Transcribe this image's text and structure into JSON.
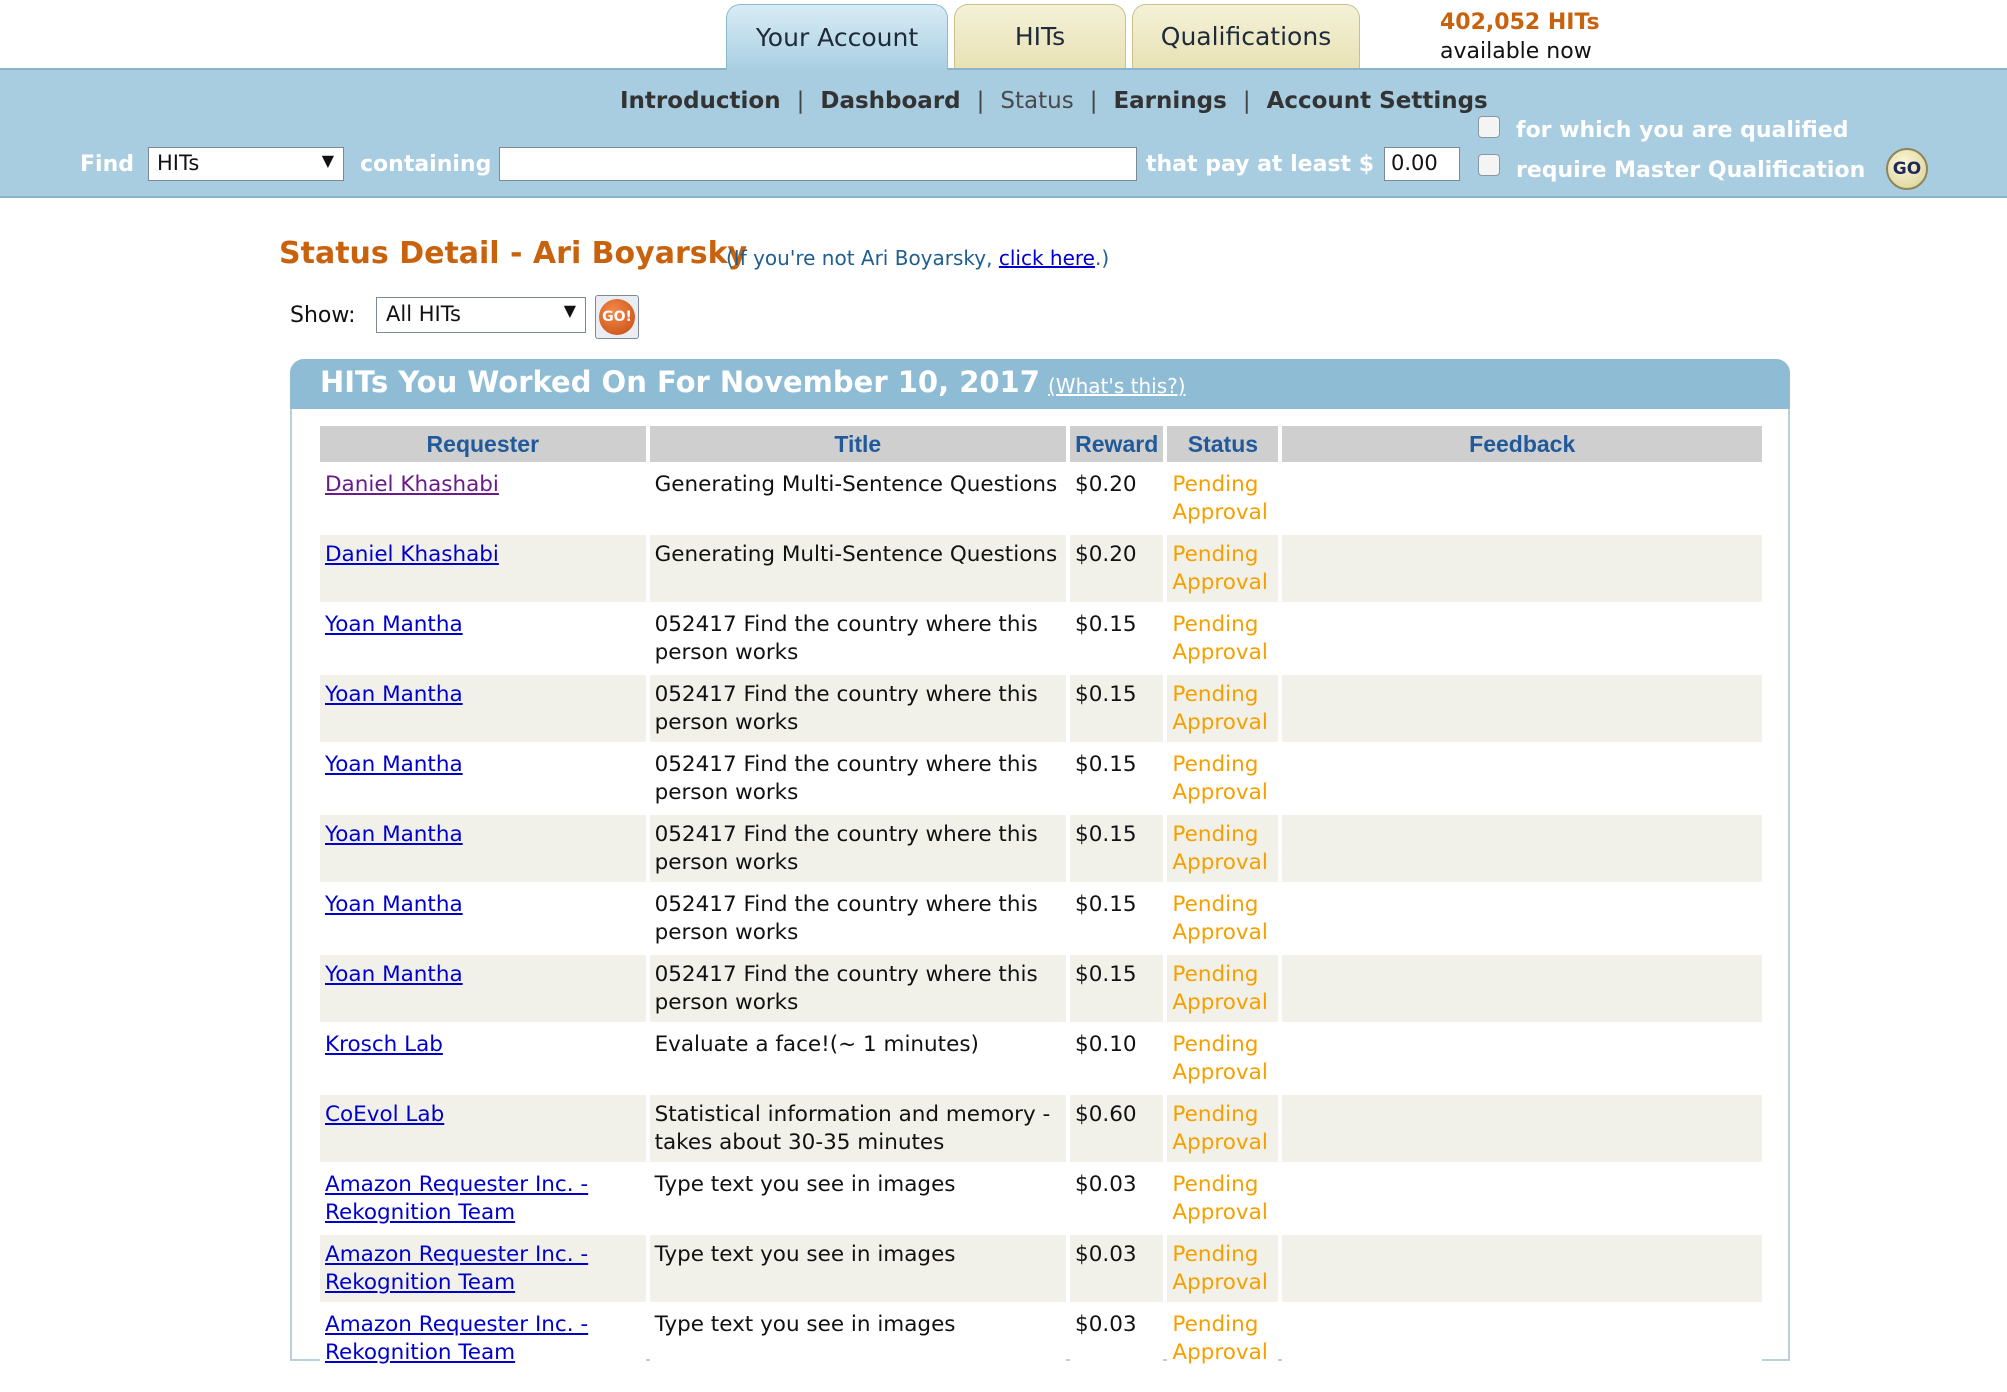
{
  "tabs": [
    {
      "label": "Your Account",
      "active": true
    },
    {
      "label": "HITs",
      "active": false
    },
    {
      "label": "Qualifications",
      "active": false
    }
  ],
  "hits_available": {
    "count": "402,052 HITs",
    "sub": "available now"
  },
  "subnav": {
    "introduction": "Introduction",
    "dashboard": "Dashboard",
    "status": "Status",
    "earnings": "Earnings",
    "account_settings": "Account Settings",
    "separator": "|"
  },
  "search": {
    "find_label": "Find",
    "find_value": "HITs",
    "containing_label": "containing",
    "query": "",
    "pay_label": "that pay at least $",
    "min_pay": "0.00",
    "qualified_label": "for which you are qualified",
    "master_label": "require Master Qualification",
    "go_label": "GO"
  },
  "status": {
    "title": "Status Detail - Ari Boyarsky",
    "note_prefix": "(If you're not Ari Boyarsky, ",
    "note_link": "click here",
    "note_suffix": ".)",
    "show_label": "Show:",
    "show_value": "All HITs",
    "show_go": "GO!"
  },
  "panel": {
    "title": "HITs You Worked On For November 10, 2017",
    "whats_this": "(What's this?)"
  },
  "table": {
    "headers": {
      "requester": "Requester",
      "title": "Title",
      "reward": "Reward",
      "status": "Status",
      "feedback": "Feedback"
    },
    "rows": [
      {
        "requester_1": "Daniel Khashabi",
        "requester_2": "",
        "title_1": "Generating Multi-Sentence Questions",
        "title_2": "",
        "reward": "$0.20",
        "status_1": "Pending",
        "status_2": "Approval",
        "feedback": ""
      },
      {
        "requester_1": "Daniel Khashabi",
        "requester_2": "",
        "title_1": "Generating Multi-Sentence Questions",
        "title_2": "",
        "reward": "$0.20",
        "status_1": "Pending",
        "status_2": "Approval",
        "feedback": ""
      },
      {
        "requester_1": "Yoan Mantha",
        "requester_2": "",
        "title_1": "052417 Find the country where this",
        "title_2": "person works",
        "reward": "$0.15",
        "status_1": "Pending",
        "status_2": "Approval",
        "feedback": ""
      },
      {
        "requester_1": "Yoan Mantha",
        "requester_2": "",
        "title_1": "052417 Find the country where this",
        "title_2": "person works",
        "reward": "$0.15",
        "status_1": "Pending",
        "status_2": "Approval",
        "feedback": ""
      },
      {
        "requester_1": "Yoan Mantha",
        "requester_2": "",
        "title_1": "052417 Find the country where this",
        "title_2": "person works",
        "reward": "$0.15",
        "status_1": "Pending",
        "status_2": "Approval",
        "feedback": ""
      },
      {
        "requester_1": "Yoan Mantha",
        "requester_2": "",
        "title_1": "052417 Find the country where this",
        "title_2": "person works",
        "reward": "$0.15",
        "status_1": "Pending",
        "status_2": "Approval",
        "feedback": ""
      },
      {
        "requester_1": "Yoan Mantha",
        "requester_2": "",
        "title_1": "052417 Find the country where this",
        "title_2": "person works",
        "reward": "$0.15",
        "status_1": "Pending",
        "status_2": "Approval",
        "feedback": ""
      },
      {
        "requester_1": "Yoan Mantha",
        "requester_2": "",
        "title_1": "052417 Find the country where this",
        "title_2": "person works",
        "reward": "$0.15",
        "status_1": "Pending",
        "status_2": "Approval",
        "feedback": ""
      },
      {
        "requester_1": "Krosch Lab",
        "requester_2": "",
        "title_1": "Evaluate a face!(~ 1 minutes)",
        "title_2": "",
        "reward": "$0.10",
        "status_1": "Pending",
        "status_2": "Approval",
        "feedback": ""
      },
      {
        "requester_1": "CoEvol Lab",
        "requester_2": "",
        "title_1": "Statistical information and memory -",
        "title_2": "takes about 30-35 minutes",
        "reward": "$0.60",
        "status_1": "Pending",
        "status_2": "Approval",
        "feedback": ""
      },
      {
        "requester_1": "Amazon Requester Inc. -",
        "requester_2": "Rekognition Team",
        "title_1": "Type text you see in images",
        "title_2": "",
        "reward": "$0.03",
        "status_1": "Pending",
        "status_2": "Approval",
        "feedback": ""
      },
      {
        "requester_1": "Amazon Requester Inc. -",
        "requester_2": "Rekognition Team",
        "title_1": "Type text you see in images",
        "title_2": "",
        "reward": "$0.03",
        "status_1": "Pending",
        "status_2": "Approval",
        "feedback": ""
      },
      {
        "requester_1": "Amazon Requester Inc. -",
        "requester_2": "Rekognition Team",
        "title_1": "Type text you see in images",
        "title_2": "",
        "reward": "$0.03",
        "status_1": "Pending",
        "status_2": "Approval",
        "feedback": ""
      }
    ]
  },
  "colors": {
    "accent_orange": "#c8620c",
    "bar_blue": "#a8cce0",
    "header_blue": "#8fbcd5",
    "status_orange": "#f5a000",
    "link_blue": "#0000cc"
  }
}
